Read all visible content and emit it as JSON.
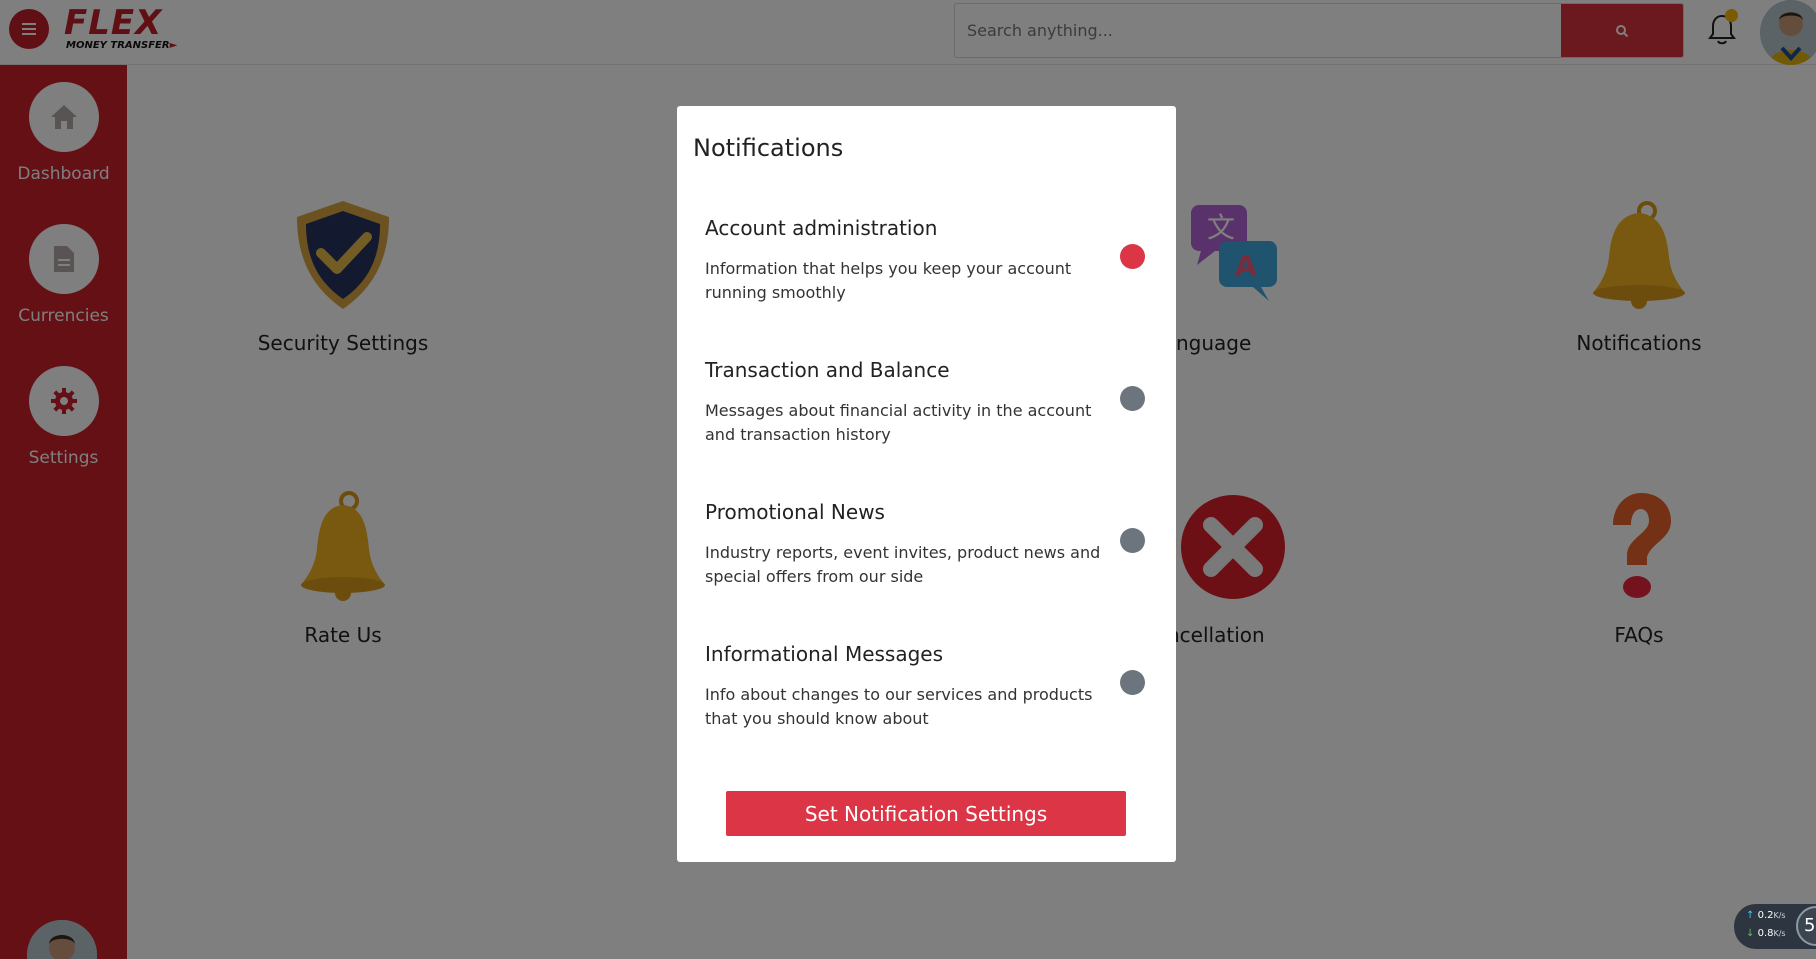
{
  "app": {
    "logo_text": "FLEX",
    "logo_subtext": "MONEY TRANSFER",
    "brand_color": "#c8202b"
  },
  "header": {
    "search_placeholder": "Search anything...",
    "search_icon": "search-icon",
    "notification_icon": "bell-icon",
    "notification_badge_color": "#f2b705"
  },
  "sidebar": {
    "items": [
      {
        "label": "Dashboard",
        "icon": "home-icon"
      },
      {
        "label": "Currencies",
        "icon": "document-icon"
      },
      {
        "label": "Settings",
        "icon": "gear-icon"
      }
    ]
  },
  "main": {
    "tiles": [
      {
        "label": "Security Settings",
        "icon": "shield-check-icon"
      },
      {
        "label": "nguage",
        "icon": "translate-icon"
      },
      {
        "label": "Notifications",
        "icon": "bell-icon"
      },
      {
        "label": "Rate Us",
        "icon": "bell-icon"
      },
      {
        "label": "ncellation",
        "icon": "x-circle-icon"
      },
      {
        "label": "FAQs",
        "icon": "question-icon"
      }
    ]
  },
  "modal": {
    "title": "Notifications",
    "items": [
      {
        "title": "Account administration",
        "description": "Information that helps you keep your account running smoothly",
        "enabled": true
      },
      {
        "title": "Transaction and Balance",
        "description": "Messages about financial activity in the account and transaction history",
        "enabled": false
      },
      {
        "title": "Promotional News",
        "description": "Industry reports, event invites, product news and special offers from our side",
        "enabled": false
      },
      {
        "title": "Informational Messages",
        "description": "Info about changes to our services and products that you should know about",
        "enabled": false
      }
    ],
    "button_label": "Set Notification Settings",
    "enabled_color": "#dc3545",
    "disabled_color": "#6c757d"
  },
  "network_widget": {
    "upload": "0.2",
    "download": "0.8",
    "unit": "K/s",
    "ring_text": "5"
  }
}
